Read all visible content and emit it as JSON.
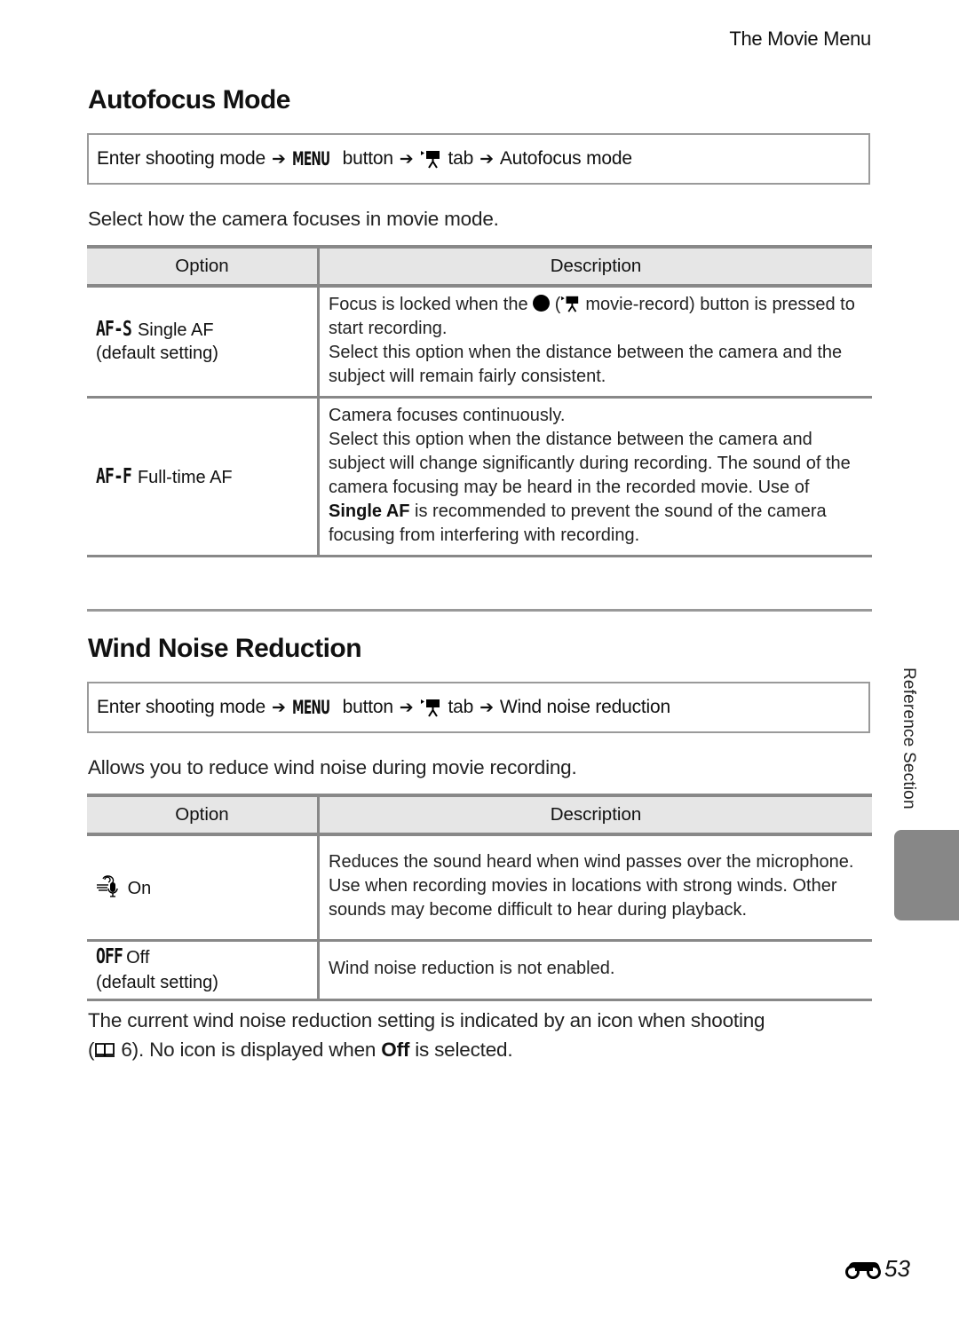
{
  "running_head": "The Movie Menu",
  "sections": [
    {
      "title": "Autofocus Mode",
      "nav_path": {
        "step1": "Enter shooting mode",
        "menu_glyph": "MENU",
        "step2": "button",
        "tab_icon": "movie-tab-icon",
        "step3": "tab",
        "step4": "Autofocus mode",
        "arrow": "➔"
      },
      "intro": "Select how the camera focuses in movie mode.",
      "table": {
        "headers": [
          "Option",
          "Description"
        ],
        "rows": [
          {
            "icon": "AF-S",
            "name": "Single AF",
            "default_note": "(default setting)",
            "desc_parts": {
              "pre": "Focus is locked when the",
              "record_icon": "record-button-icon",
              "open_paren": "(",
              "mid": "movie-record) button is pressed to start recording.",
              "line2": "Select this option when the distance between the camera and the subject will remain fairly consistent."
            }
          },
          {
            "icon": "AF-F",
            "name": "Full-time AF",
            "desc_parts": {
              "line1": "Camera focuses continuously.",
              "line2": "Select this option when the distance between the camera and subject will change significantly during recording. The sound of the camera focusing may be heard in the recorded movie. Use of",
              "bold": "Single AF",
              "line3": "is recommended to prevent the sound of the camera focusing from interfering with recording."
            }
          }
        ]
      }
    },
    {
      "title": "Wind Noise Reduction",
      "nav_path": {
        "step1": "Enter shooting mode",
        "menu_glyph": "MENU",
        "step2": "button",
        "tab_icon": "movie-tab-icon",
        "step3": "tab",
        "step4": "Wind noise reduction",
        "arrow": "➔"
      },
      "intro": "Allows you to reduce wind noise during movie recording.",
      "table": {
        "headers": [
          "Option",
          "Description"
        ],
        "rows": [
          {
            "icon": "wind-noise-icon",
            "name": "On",
            "description": "Reduces the sound heard when wind passes over the microphone. Use when recording movies in locations with strong winds. Other sounds may become difficult to hear during playback."
          },
          {
            "icon": "OFF",
            "name": "Off",
            "default_note": "(default setting)",
            "description": "Wind noise reduction is not enabled."
          }
        ]
      },
      "note": {
        "pre": "The current wind noise reduction setting is indicated by an icon when shooting",
        "open_paren": "(",
        "page_ref": "6). No icon is displayed when",
        "bold": "Off",
        "post": "is selected."
      }
    }
  ],
  "side_label": "Reference Section",
  "page_number": "53",
  "colors": {
    "header_bg": "#e6e6e6",
    "rule": "#888888",
    "side_tab": "#878787"
  }
}
